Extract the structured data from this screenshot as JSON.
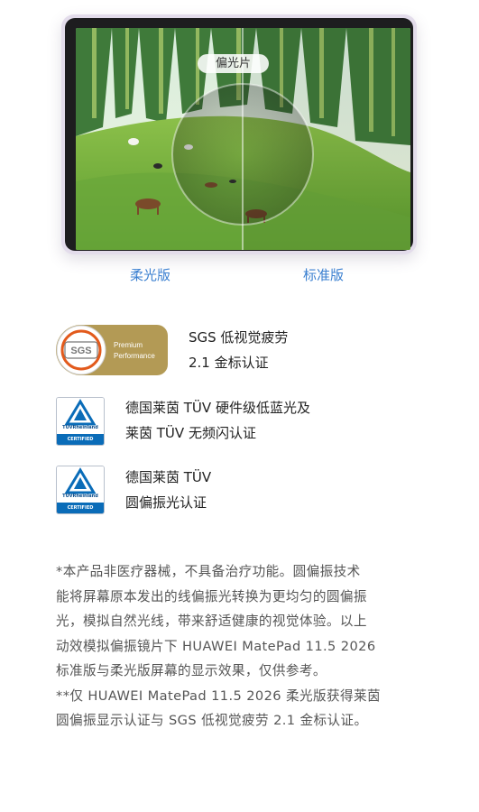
{
  "hero": {
    "polarizer_label": "偏光片",
    "caption_left": "柔光版",
    "caption_right": "标准版"
  },
  "certifications": [
    {
      "badge": {
        "line1": "Premium",
        "line2": "Performance",
        "logo": "SGS"
      },
      "line1": "SGS 低视觉疲劳",
      "line2": "2.1 金标认证"
    },
    {
      "badge": {
        "brand": "TÜVRheinland",
        "band": "CERTIFIED"
      },
      "line1": "德国莱茵 TÜV 硬件级低蓝光及",
      "line2": "莱茵 TÜV 无频闪认证"
    },
    {
      "badge": {
        "brand": "TÜVRheinland",
        "band": "CERTIFIED"
      },
      "line1": "德国莱茵 TÜV",
      "line2": "圆偏振光认证"
    }
  ],
  "footnote": {
    "lines": [
      "*本产品非医疗器械，不具备治疗功能。圆偏振技术",
      "能将屏幕原本发出的线偏振光转换为更均匀的圆偏振",
      "光，模拟自然光线，带来舒适健康的视觉体验。以上",
      "动效模拟偏振镜片下 HUAWEI MatePad 11.5 2026",
      "标准版与柔光版屏幕的显示效果，仅供参考。",
      "**仅 HUAWEI MatePad 11.5 2026 柔光版获得莱茵",
      "圆偏振显示认证与 SGS 低视觉疲劳 2.1 金标认证。"
    ]
  },
  "colors": {
    "caption_blue": "#3a7fd0",
    "sgs_gold": "#b39a55",
    "tuv_blue": "#0a6cb8"
  }
}
